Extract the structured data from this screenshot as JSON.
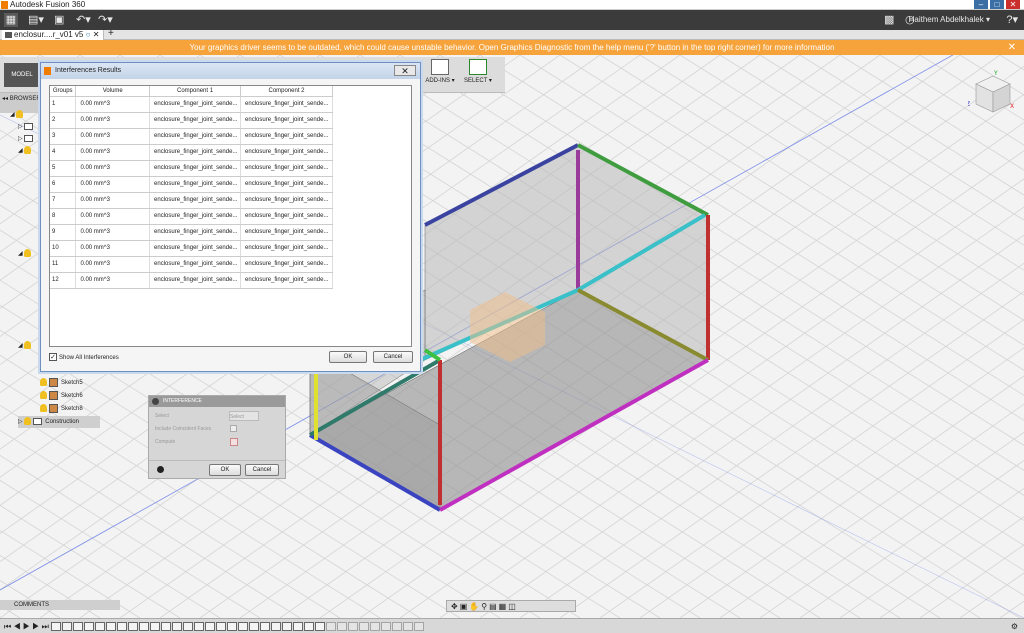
{
  "app": {
    "title": "Autodesk Fusion 360",
    "user": "Haithem Abdelkhalek"
  },
  "document_tab": {
    "label": "enclosur....r_v01 v5"
  },
  "warning": {
    "text": "Your graphics driver seems to be outdated, which could cause unstable behavior. Open Graphics Diagnostic from the help menu ('?' button in the top right corner) for more information"
  },
  "toolbar": {
    "mode_label": "MODEL",
    "addins_label": "ADD-INS ▾",
    "select_label": "SELECT ▾"
  },
  "browser": {
    "label": "BROWSER",
    "items": [
      "Sketch5",
      "Sketch6",
      "Sketch8",
      "Construction"
    ]
  },
  "dialog": {
    "title": "Interferences Results",
    "columns": [
      "Groups",
      "Volume",
      "Component 1",
      "Component 2"
    ],
    "rows": [
      [
        "1",
        "0.00 mm^3",
        "enclosure_finger_joint_sende...",
        "enclosure_finger_joint_sende..."
      ],
      [
        "2",
        "0.00 mm^3",
        "enclosure_finger_joint_sende...",
        "enclosure_finger_joint_sende..."
      ],
      [
        "3",
        "0.00 mm^3",
        "enclosure_finger_joint_sende...",
        "enclosure_finger_joint_sende..."
      ],
      [
        "4",
        "0.00 mm^3",
        "enclosure_finger_joint_sende...",
        "enclosure_finger_joint_sende..."
      ],
      [
        "5",
        "0.00 mm^3",
        "enclosure_finger_joint_sende...",
        "enclosure_finger_joint_sende..."
      ],
      [
        "6",
        "0.00 mm^3",
        "enclosure_finger_joint_sende...",
        "enclosure_finger_joint_sende..."
      ],
      [
        "7",
        "0.00 mm^3",
        "enclosure_finger_joint_sende...",
        "enclosure_finger_joint_sende..."
      ],
      [
        "8",
        "0.00 mm^3",
        "enclosure_finger_joint_sende...",
        "enclosure_finger_joint_sende..."
      ],
      [
        "9",
        "0.00 mm^3",
        "enclosure_finger_joint_sende...",
        "enclosure_finger_joint_sende..."
      ],
      [
        "10",
        "0.00 mm^3",
        "enclosure_finger_joint_sende...",
        "enclosure_finger_joint_sende..."
      ],
      [
        "11",
        "0.00 mm^3",
        "enclosure_finger_joint_sende...",
        "enclosure_finger_joint_sende..."
      ],
      [
        "12",
        "0.00 mm^3",
        "enclosure_finger_joint_sende...",
        "enclosure_finger_joint_sende..."
      ]
    ],
    "show_all_label": "Show All Interferences",
    "show_all_checked": true,
    "ok_label": "OK",
    "cancel_label": "Cancel"
  },
  "interference_panel": {
    "title": "INTERFERENCE",
    "select_label": "Select",
    "select_button": "Select",
    "coincident_label": "Include Coincident Faces",
    "compute_label": "Compute",
    "ok_label": "OK",
    "cancel_label": "Cancel"
  },
  "comments": {
    "label": "COMMENTS"
  },
  "colors": {
    "warning": "#f7a33b",
    "accent": "#3b6ea5",
    "appbar": "#3b3b3b"
  }
}
